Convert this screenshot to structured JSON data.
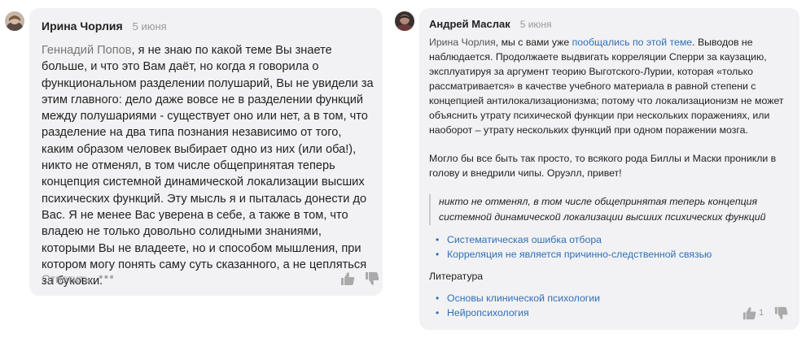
{
  "comment_left": {
    "author": "Ирина Чорлия",
    "date": "5 июня",
    "mention": "Геннадий Попов",
    "text": ", я не знаю по какой теме Вы знаете больше, и что это Вам даёт, но когда я говорила о функциональном разделении полушарий, Вы не увидели за этим главного: дело даже вовсе не в разделении функций между полушариями - существует оно или нет, а в том, что разделение на два типа познания независимо от того, каким образом человек выбирает одно из них (или оба!), никто не отменял, в том числе общепринятая теперь концепция системной динамической локализации высших психических функций. Эту мысль я и пыталась донести до Вас. Я не менее Вас уверена в себе, а также в том, что владею не только довольно солидными знаниями, которыми Вы не владеете, но и способом мышления, при котором могу понять саму суть сказанного, а не цепляться за буковки.",
    "reply_label": "Ответить",
    "more_icon": "ellipsis-icon",
    "like_icon": "thumbs-up-icon",
    "dislike_icon": "thumbs-down-icon"
  },
  "comment_right": {
    "author": "Андрей Маслак",
    "date": "5 июня",
    "mention": "Ирина Чорлия",
    "p1_before": ", мы с вами уже ",
    "p1_link": "пообщались по этой теме",
    "p1_after": ". Выводов не наблюдается. Продолжаете выдвигать корреляции Сперри за каузацию, эксплуатируя за аргумент теорию Выготского-Лурии, которая «только рассматривается» в качестве учебного материала в равной степени с концепцией антилокализационизма; потому что локализационизм не может объяснить утрату психической функции при нескольких поражениях, или наоборот – утрату нескольких функций при одном поражении мозга.",
    "p2": "Могло бы все быть так просто, то всякого рода Биллы и Маски проникли в голову и внедрили чипы. Оруэлл, привет!",
    "quote": "никто не отменял, в том числе общепринятая теперь концепция системной динамической локализации высших психических функций",
    "links": [
      "Систематическая ошибка отбора",
      "Корреляция не является причинно-следственной связью"
    ],
    "literature_label": "Литература",
    "literature": [
      "Основы клинической психологии",
      "Нейропсихология"
    ],
    "likes": "1",
    "like_icon": "thumbs-up-icon",
    "dislike_icon": "thumbs-down-icon"
  },
  "colors": {
    "card_bg": "#f2f2f4",
    "link": "#2f6fb5",
    "muted": "#9a9a9a"
  }
}
